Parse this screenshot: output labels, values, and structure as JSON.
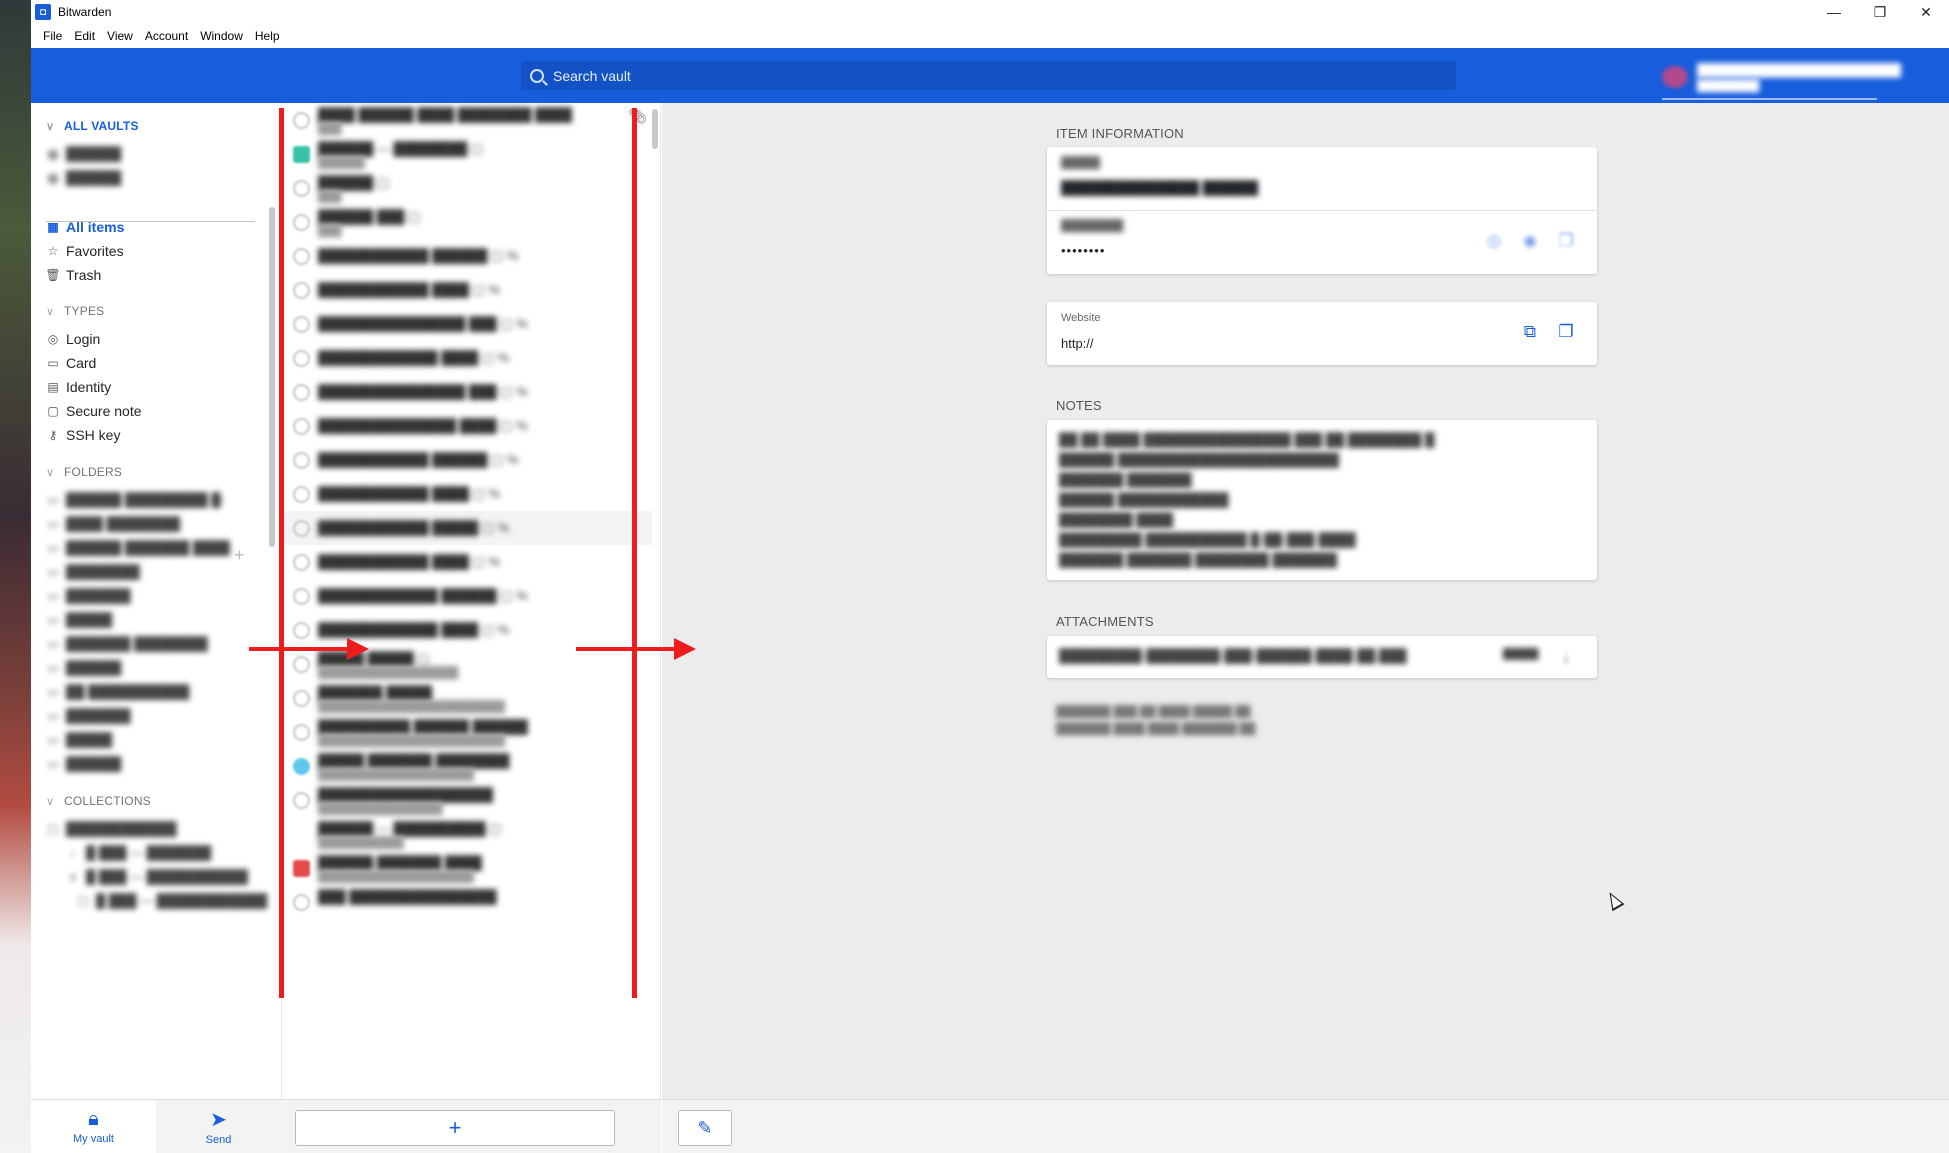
{
  "window": {
    "title": "Bitwarden",
    "controls": [
      "—",
      "❐",
      "✕"
    ]
  },
  "menu": [
    "File",
    "Edit",
    "View",
    "Account",
    "Window",
    "Help"
  ],
  "header": {
    "search_placeholder": "Search vault",
    "account_name": "████████████████████████",
    "account_status": "████████"
  },
  "sidebar": {
    "all_vaults": "ALL VAULTS",
    "vaults": [
      "██████",
      "██████"
    ],
    "all_items": "All items",
    "favorites": "Favorites",
    "trash": "Trash",
    "types_heading": "TYPES",
    "types": [
      "Login",
      "Card",
      "Identity",
      "Secure note",
      "SSH key"
    ],
    "folders_heading": "FOLDERS",
    "folders": [
      "██████ █████████ █-",
      "████ ████████",
      "██████ ███████ ████",
      "████████",
      "███████",
      "█████",
      "███████ ████████",
      "██████",
      "██ ███████████",
      "███████",
      "█████",
      "██████"
    ],
    "collections_heading": "COLLECTIONS",
    "collections": [
      "████████████",
      "█ ███ — ███████",
      "█ ███ — ███████████",
      "█ ███ — ████████████"
    ]
  },
  "bottom_nav": {
    "my_vault": "My vault",
    "send": "Send"
  },
  "list": {
    "items": [
      {
        "title": "████ ██████ ████ ████████ ████",
        "sub": "███"
      },
      {
        "title": "██████ — ████████ ▢",
        "sub": "██████"
      },
      {
        "title": "██████ ▢",
        "sub": "███"
      },
      {
        "title": "██████ ███ ▢",
        "sub": "███"
      },
      {
        "title": "████████████ ██████ ▢ %"
      },
      {
        "title": "████████████ ████ ▢ %"
      },
      {
        "title": "████████████████ ███ ▢ %"
      },
      {
        "title": "█████████████ ████ ▢ %"
      },
      {
        "title": "████████████████ ███ ▢ %"
      },
      {
        "title": "███████████████ ████ ▢ %"
      },
      {
        "title": "████████████ ██████ ▢ %"
      },
      {
        "title": "████████████ ████ ▢ %"
      },
      {
        "title": "████████████ █████ ▢ %"
      },
      {
        "title": "████████████ ████ ▢ %"
      },
      {
        "title": "█████████████ ██████ ▢ %"
      },
      {
        "title": "█████████████ ████ ▢ %"
      },
      {
        "title": "█████ █████ ▢",
        "sub": "██████████████████"
      },
      {
        "title": "███████ █████",
        "sub": "████████████████████████"
      },
      {
        "title": "██████████ ██████ ██████",
        "sub": "████████████████████████"
      },
      {
        "title": "█████ ███████ ████████",
        "sub": "████████████████████"
      },
      {
        "title": "███████████████████",
        "sub": "████████████████"
      },
      {
        "title": "██████ — ██████████ ▢",
        "sub": "███████████"
      },
      {
        "title": "██████ ███████ ████",
        "sub": "████████████████████"
      },
      {
        "title": "███ ████████████████",
        "sub": ""
      }
    ]
  },
  "detail": {
    "item_information_heading": "ITEM INFORMATION",
    "name_label": "█████",
    "name_value": "███████████████ ██████",
    "password_label": "████████",
    "password_value": "••••••••",
    "website_label": "Website",
    "website_value": "http://",
    "notes_heading": "NOTES",
    "notes_lines": [
      "██ ██ ████ ████████████████ ███ ██ ████████ █",
      "██████ ████████████████████████",
      "███████ ███████",
      "██████ ████████████",
      "████████ ████",
      "█████████ ███████████ █-██-███-████",
      "███████ ███████ ████████ ███████"
    ],
    "attachments_heading": "ATTACHMENTS",
    "attachment_name": "█████████-████████-███-██████-████-██.███",
    "attachment_size": "█████",
    "meta_updated": "███████ ███ ██ ████ █████ ██",
    "meta_created": "███████ ████ ████ ███████ ██"
  },
  "colors": {
    "brand": "#175ddc",
    "annotation": "#ee1c1c",
    "detail_bg": "#ececec"
  }
}
